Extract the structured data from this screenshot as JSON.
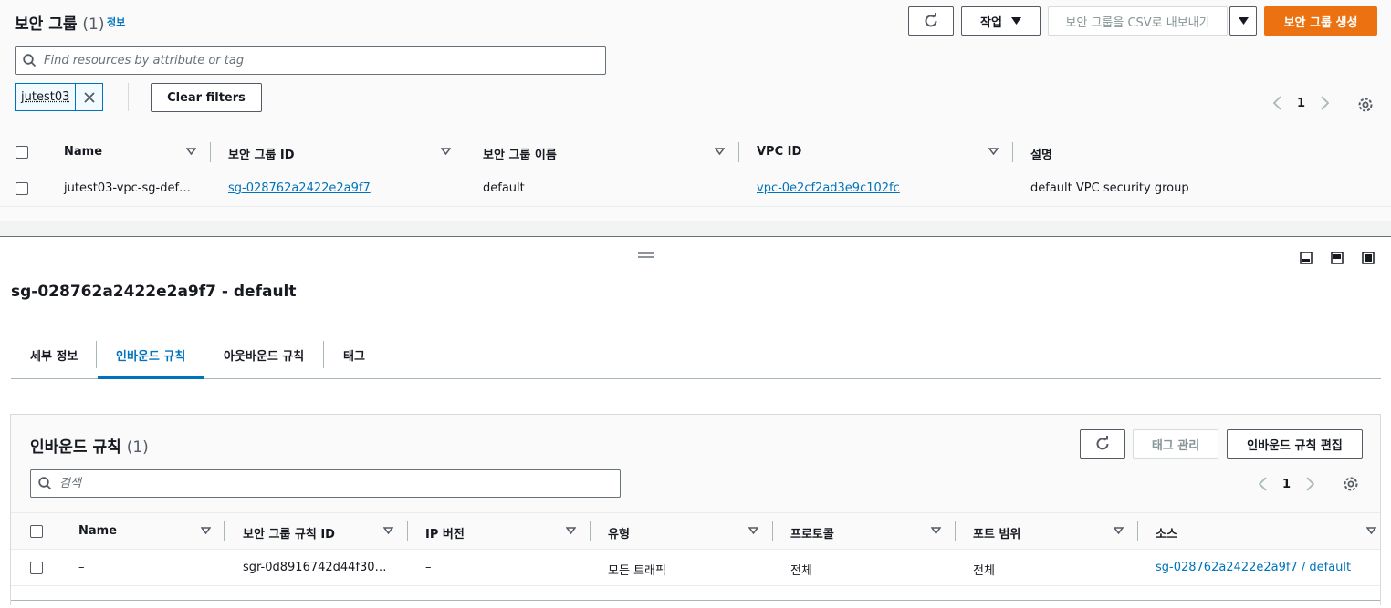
{
  "top": {
    "title": "보안 그룹",
    "count": "(1)",
    "info": "정보",
    "actions_label": "작업",
    "export_label": "보안 그룹을 CSV로 내보내기",
    "create_label": "보안 그룹 생성",
    "search_placeholder": "Find resources by attribute or tag",
    "filter_token": "jutest03",
    "clear_filters": "Clear filters",
    "page": "1",
    "columns": [
      "Name",
      "보안 그룹 ID",
      "보안 그룹 이름",
      "VPC ID",
      "설명"
    ],
    "rows": [
      {
        "name": "jutest03-vpc-sg-def…",
        "sg_id": "sg-028762a2422e2a9f7",
        "sg_name": "default",
        "vpc_id": "vpc-0e2cf2ad3e9c102fc",
        "desc": "default VPC security group"
      }
    ]
  },
  "detail": {
    "title": "sg-028762a2422e2a9f7 - default",
    "tabs": [
      "세부 정보",
      "인바운드 규칙",
      "아웃바운드 규칙",
      "태그"
    ],
    "active_tab": 1
  },
  "inbound": {
    "title": "인바운드 규칙",
    "count": "(1)",
    "manage_tags": "태그 관리",
    "edit_rules": "인바운드 규칙 편집",
    "search_placeholder": "검색",
    "page": "1",
    "columns": [
      "Name",
      "보안 그룹 규칙 ID",
      "IP 버전",
      "유형",
      "프로토콜",
      "포트 범위",
      "소스"
    ],
    "rows": [
      {
        "name": "–",
        "rule_id": "sgr-0d8916742d44f30…",
        "ip_version": "–",
        "type": "모든 트래픽",
        "protocol": "전체",
        "port_range": "전체",
        "source": "sg-028762a2422e2a9f7 / default"
      }
    ]
  },
  "colors": {
    "primary": "#ec7211",
    "link": "#0073bb"
  }
}
